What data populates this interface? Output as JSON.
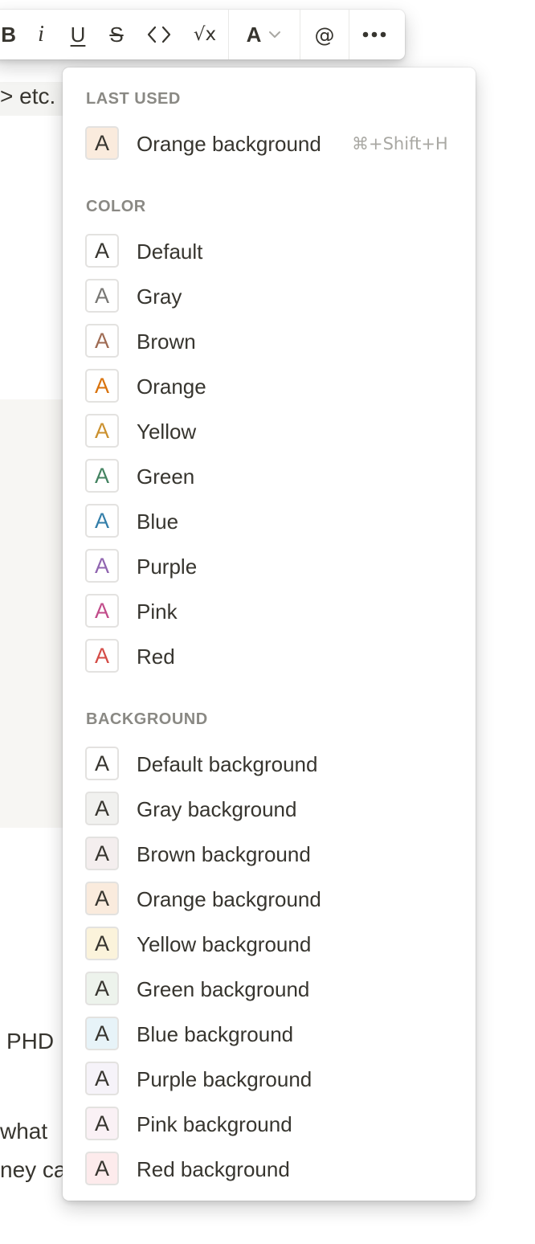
{
  "toolbar": {
    "bold": "B",
    "italic": "i",
    "underline": "U",
    "strike": "S",
    "code": "<>",
    "math": "√x",
    "color": "A",
    "mention": "@"
  },
  "background_doc": {
    "fragment_1": "> etc.",
    "fragment_2": "PHD",
    "fragment_3": "what",
    "fragment_4": "ney ca"
  },
  "menu": {
    "last_used": {
      "title": "LAST USED",
      "items": [
        {
          "glyph": "A",
          "label": "Orange background",
          "shortcut": "⌘+Shift+H",
          "text_color": "#37352f",
          "bg_color": "#faebdd"
        }
      ]
    },
    "color": {
      "title": "COLOR",
      "items": [
        {
          "glyph": "A",
          "label": "Default",
          "text_color": "#37352f"
        },
        {
          "glyph": "A",
          "label": "Gray",
          "text_color": "#787774"
        },
        {
          "glyph": "A",
          "label": "Brown",
          "text_color": "#9f6b53"
        },
        {
          "glyph": "A",
          "label": "Orange",
          "text_color": "#d9730d"
        },
        {
          "glyph": "A",
          "label": "Yellow",
          "text_color": "#cb912f"
        },
        {
          "glyph": "A",
          "label": "Green",
          "text_color": "#448361"
        },
        {
          "glyph": "A",
          "label": "Blue",
          "text_color": "#337ea9"
        },
        {
          "glyph": "A",
          "label": "Purple",
          "text_color": "#9065b0"
        },
        {
          "glyph": "A",
          "label": "Pink",
          "text_color": "#c14c8a"
        },
        {
          "glyph": "A",
          "label": "Red",
          "text_color": "#d44c47"
        }
      ]
    },
    "background": {
      "title": "BACKGROUND",
      "items": [
        {
          "glyph": "A",
          "label": "Default background",
          "bg_color": "#ffffff"
        },
        {
          "glyph": "A",
          "label": "Gray background",
          "bg_color": "#f1f1ef"
        },
        {
          "glyph": "A",
          "label": "Brown background",
          "bg_color": "#f4eeee"
        },
        {
          "glyph": "A",
          "label": "Orange background",
          "bg_color": "#faebdd"
        },
        {
          "glyph": "A",
          "label": "Yellow background",
          "bg_color": "#fbf3db"
        },
        {
          "glyph": "A",
          "label": "Green background",
          "bg_color": "#edf3ec"
        },
        {
          "glyph": "A",
          "label": "Blue background",
          "bg_color": "#e7f3f8"
        },
        {
          "glyph": "A",
          "label": "Purple background",
          "bg_color": "#f6f3f9"
        },
        {
          "glyph": "A",
          "label": "Pink background",
          "bg_color": "#faf1f5"
        },
        {
          "glyph": "A",
          "label": "Red background",
          "bg_color": "#fdebec"
        }
      ]
    }
  }
}
